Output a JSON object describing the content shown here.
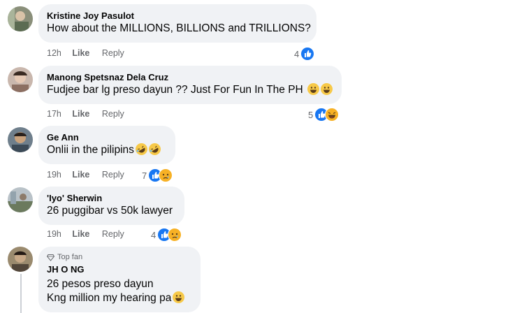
{
  "comments": [
    {
      "author": "Kristine Joy Pasulot",
      "text": "How about the MILLIONS, BILLIONS and TRILLIONS?",
      "time": "12h",
      "like": "Like",
      "reply": "Reply",
      "reaction_count": "4",
      "reactions": [
        "like"
      ]
    },
    {
      "author": "Manong Spetsnaz Dela Cruz",
      "text": "Fudjee bar lg preso dayun ?? Just For Fun In The PH",
      "emojis": [
        "grin",
        "grin"
      ],
      "time": "17h",
      "like": "Like",
      "reply": "Reply",
      "reaction_count": "5",
      "reactions": [
        "like",
        "haha"
      ]
    },
    {
      "author": "Ge Ann",
      "text": "Onlii in the pilipins",
      "emojis": [
        "rofl",
        "rofl"
      ],
      "time": "19h",
      "like": "Like",
      "reply": "Reply",
      "reaction_count": "7",
      "reactions": [
        "like",
        "sad"
      ]
    },
    {
      "author": "'Iyo' Sherwin",
      "text": "26 puggibar vs 50k lawyer",
      "time": "19h",
      "like": "Like",
      "reply": "Reply",
      "reaction_count": "4",
      "reactions": [
        "like",
        "sad"
      ]
    },
    {
      "badge": "Top fan",
      "author": "JH O NG",
      "text_lines": [
        "26 pesos preso dayun",
        "Kng million my hearing pa"
      ],
      "emojis": [
        "grin"
      ]
    }
  ],
  "colors": {
    "bubble": "#f0f2f5",
    "like_blue": "#1877f2",
    "emoji_yellow": "#f7c948",
    "meta_gray": "#65676b"
  }
}
